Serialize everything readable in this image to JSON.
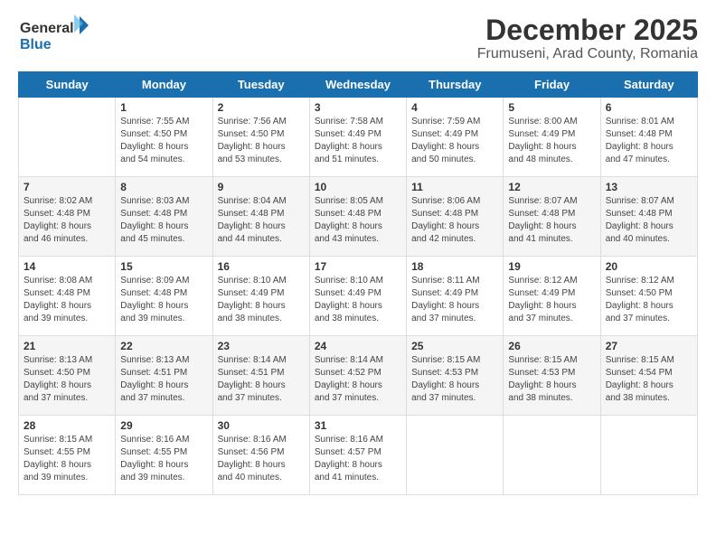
{
  "logo": {
    "line1": "General",
    "line2": "Blue"
  },
  "title": "December 2025",
  "subtitle": "Frumuseni, Arad County, Romania",
  "weekdays": [
    "Sunday",
    "Monday",
    "Tuesday",
    "Wednesday",
    "Thursday",
    "Friday",
    "Saturday"
  ],
  "weeks": [
    [
      {
        "day": "",
        "info": ""
      },
      {
        "day": "1",
        "info": "Sunrise: 7:55 AM\nSunset: 4:50 PM\nDaylight: 8 hours\nand 54 minutes."
      },
      {
        "day": "2",
        "info": "Sunrise: 7:56 AM\nSunset: 4:50 PM\nDaylight: 8 hours\nand 53 minutes."
      },
      {
        "day": "3",
        "info": "Sunrise: 7:58 AM\nSunset: 4:49 PM\nDaylight: 8 hours\nand 51 minutes."
      },
      {
        "day": "4",
        "info": "Sunrise: 7:59 AM\nSunset: 4:49 PM\nDaylight: 8 hours\nand 50 minutes."
      },
      {
        "day": "5",
        "info": "Sunrise: 8:00 AM\nSunset: 4:49 PM\nDaylight: 8 hours\nand 48 minutes."
      },
      {
        "day": "6",
        "info": "Sunrise: 8:01 AM\nSunset: 4:48 PM\nDaylight: 8 hours\nand 47 minutes."
      }
    ],
    [
      {
        "day": "7",
        "info": "Sunrise: 8:02 AM\nSunset: 4:48 PM\nDaylight: 8 hours\nand 46 minutes."
      },
      {
        "day": "8",
        "info": "Sunrise: 8:03 AM\nSunset: 4:48 PM\nDaylight: 8 hours\nand 45 minutes."
      },
      {
        "day": "9",
        "info": "Sunrise: 8:04 AM\nSunset: 4:48 PM\nDaylight: 8 hours\nand 44 minutes."
      },
      {
        "day": "10",
        "info": "Sunrise: 8:05 AM\nSunset: 4:48 PM\nDaylight: 8 hours\nand 43 minutes."
      },
      {
        "day": "11",
        "info": "Sunrise: 8:06 AM\nSunset: 4:48 PM\nDaylight: 8 hours\nand 42 minutes."
      },
      {
        "day": "12",
        "info": "Sunrise: 8:07 AM\nSunset: 4:48 PM\nDaylight: 8 hours\nand 41 minutes."
      },
      {
        "day": "13",
        "info": "Sunrise: 8:07 AM\nSunset: 4:48 PM\nDaylight: 8 hours\nand 40 minutes."
      }
    ],
    [
      {
        "day": "14",
        "info": "Sunrise: 8:08 AM\nSunset: 4:48 PM\nDaylight: 8 hours\nand 39 minutes."
      },
      {
        "day": "15",
        "info": "Sunrise: 8:09 AM\nSunset: 4:48 PM\nDaylight: 8 hours\nand 39 minutes."
      },
      {
        "day": "16",
        "info": "Sunrise: 8:10 AM\nSunset: 4:49 PM\nDaylight: 8 hours\nand 38 minutes."
      },
      {
        "day": "17",
        "info": "Sunrise: 8:10 AM\nSunset: 4:49 PM\nDaylight: 8 hours\nand 38 minutes."
      },
      {
        "day": "18",
        "info": "Sunrise: 8:11 AM\nSunset: 4:49 PM\nDaylight: 8 hours\nand 37 minutes."
      },
      {
        "day": "19",
        "info": "Sunrise: 8:12 AM\nSunset: 4:49 PM\nDaylight: 8 hours\nand 37 minutes."
      },
      {
        "day": "20",
        "info": "Sunrise: 8:12 AM\nSunset: 4:50 PM\nDaylight: 8 hours\nand 37 minutes."
      }
    ],
    [
      {
        "day": "21",
        "info": "Sunrise: 8:13 AM\nSunset: 4:50 PM\nDaylight: 8 hours\nand 37 minutes."
      },
      {
        "day": "22",
        "info": "Sunrise: 8:13 AM\nSunset: 4:51 PM\nDaylight: 8 hours\nand 37 minutes."
      },
      {
        "day": "23",
        "info": "Sunrise: 8:14 AM\nSunset: 4:51 PM\nDaylight: 8 hours\nand 37 minutes."
      },
      {
        "day": "24",
        "info": "Sunrise: 8:14 AM\nSunset: 4:52 PM\nDaylight: 8 hours\nand 37 minutes."
      },
      {
        "day": "25",
        "info": "Sunrise: 8:15 AM\nSunset: 4:53 PM\nDaylight: 8 hours\nand 37 minutes."
      },
      {
        "day": "26",
        "info": "Sunrise: 8:15 AM\nSunset: 4:53 PM\nDaylight: 8 hours\nand 38 minutes."
      },
      {
        "day": "27",
        "info": "Sunrise: 8:15 AM\nSunset: 4:54 PM\nDaylight: 8 hours\nand 38 minutes."
      }
    ],
    [
      {
        "day": "28",
        "info": "Sunrise: 8:15 AM\nSunset: 4:55 PM\nDaylight: 8 hours\nand 39 minutes."
      },
      {
        "day": "29",
        "info": "Sunrise: 8:16 AM\nSunset: 4:55 PM\nDaylight: 8 hours\nand 39 minutes."
      },
      {
        "day": "30",
        "info": "Sunrise: 8:16 AM\nSunset: 4:56 PM\nDaylight: 8 hours\nand 40 minutes."
      },
      {
        "day": "31",
        "info": "Sunrise: 8:16 AM\nSunset: 4:57 PM\nDaylight: 8 hours\nand 41 minutes."
      },
      {
        "day": "",
        "info": ""
      },
      {
        "day": "",
        "info": ""
      },
      {
        "day": "",
        "info": ""
      }
    ]
  ]
}
